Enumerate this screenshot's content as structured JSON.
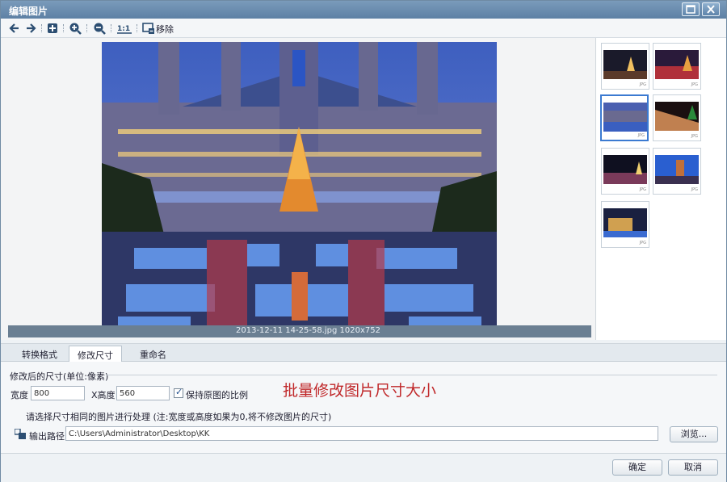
{
  "window": {
    "title": "编辑图片"
  },
  "toolbar": {
    "move_label": "移除"
  },
  "preview": {
    "caption": "2013-12-11 14-25-58.jpg   1020x752"
  },
  "thumbnails": [
    {
      "ext": "JPG",
      "selected": false
    },
    {
      "ext": "JPG",
      "selected": false
    },
    {
      "ext": "JPG",
      "selected": true
    },
    {
      "ext": "JPG",
      "selected": false
    },
    {
      "ext": "JPG",
      "selected": false
    },
    {
      "ext": "JPG",
      "selected": false
    },
    {
      "ext": "JPG",
      "selected": false
    }
  ],
  "tabs": [
    {
      "label": "转换格式",
      "active": false
    },
    {
      "label": "修改尺寸",
      "active": true
    },
    {
      "label": "重命名",
      "active": false
    }
  ],
  "resize": {
    "section_title": "修改后的尺寸(单位:像素)",
    "width_label": "宽度",
    "width_value": "800",
    "height_label": "X高度",
    "height_value": "560",
    "keep_ratio_label": "保持原图的比例",
    "keep_ratio_checked": true,
    "overlay_text": "批量修改图片尺寸大小",
    "hint": "请选择尺寸相同的图片进行处理 (注:宽度或高度如果为0,将不修改图片的尺寸)",
    "output_label": "输出路径",
    "output_path": "C:\\Users\\Administrator\\Desktop\\KK",
    "browse_label": "浏览..."
  },
  "footer": {
    "ok_label": "确定",
    "cancel_label": "取消"
  }
}
